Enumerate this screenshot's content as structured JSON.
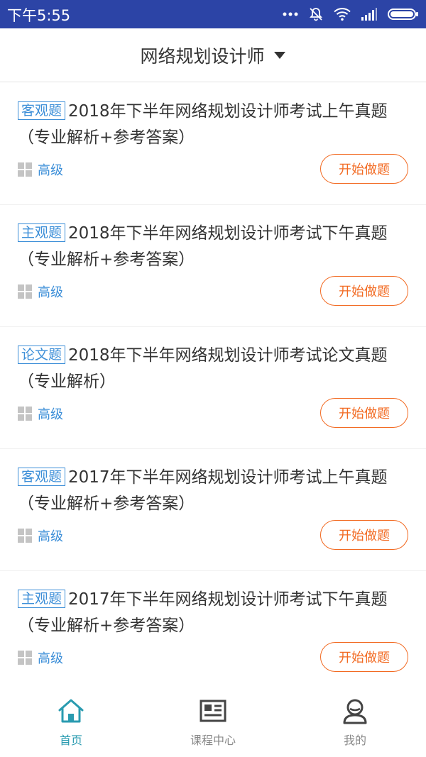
{
  "status_bar": {
    "time": "下午5:55",
    "icons": [
      "more-dots-icon",
      "mute-icon",
      "wifi-icon",
      "signal-icon",
      "battery-icon"
    ]
  },
  "header": {
    "title": "网络规划设计师",
    "dropdown_icon": "caret-down-icon"
  },
  "items": [
    {
      "tag": "客观题",
      "title": "2018年下半年网络规划设计师考试上午真题（专业解析+参考答案）",
      "level": "高级",
      "button": "开始做题"
    },
    {
      "tag": "主观题",
      "title": "2018年下半年网络规划设计师考试下午真题（专业解析+参考答案）",
      "level": "高级",
      "button": "开始做题"
    },
    {
      "tag": "论文题",
      "title": "2018年下半年网络规划设计师考试论文真题（专业解析）",
      "level": "高级",
      "button": "开始做题"
    },
    {
      "tag": "客观题",
      "title": "2017年下半年网络规划设计师考试上午真题（专业解析+参考答案）",
      "level": "高级",
      "button": "开始做题"
    },
    {
      "tag": "主观题",
      "title": "2017年下半年网络规划设计师考试下午真题（专业解析+参考答案）",
      "level": "高级",
      "button": "开始做题"
    }
  ],
  "tabbar": {
    "tabs": [
      {
        "label": "首页",
        "icon": "home-icon",
        "active": true
      },
      {
        "label": "课程中心",
        "icon": "book-icon",
        "active": false
      },
      {
        "label": "我的",
        "icon": "user-icon",
        "active": false
      }
    ]
  },
  "colors": {
    "status_bar": "#2c44a6",
    "tag_blue": "#3d8fd8",
    "button_orange": "#f26a22",
    "tab_active": "#2a9bb0",
    "tab_inactive": "#444444"
  }
}
